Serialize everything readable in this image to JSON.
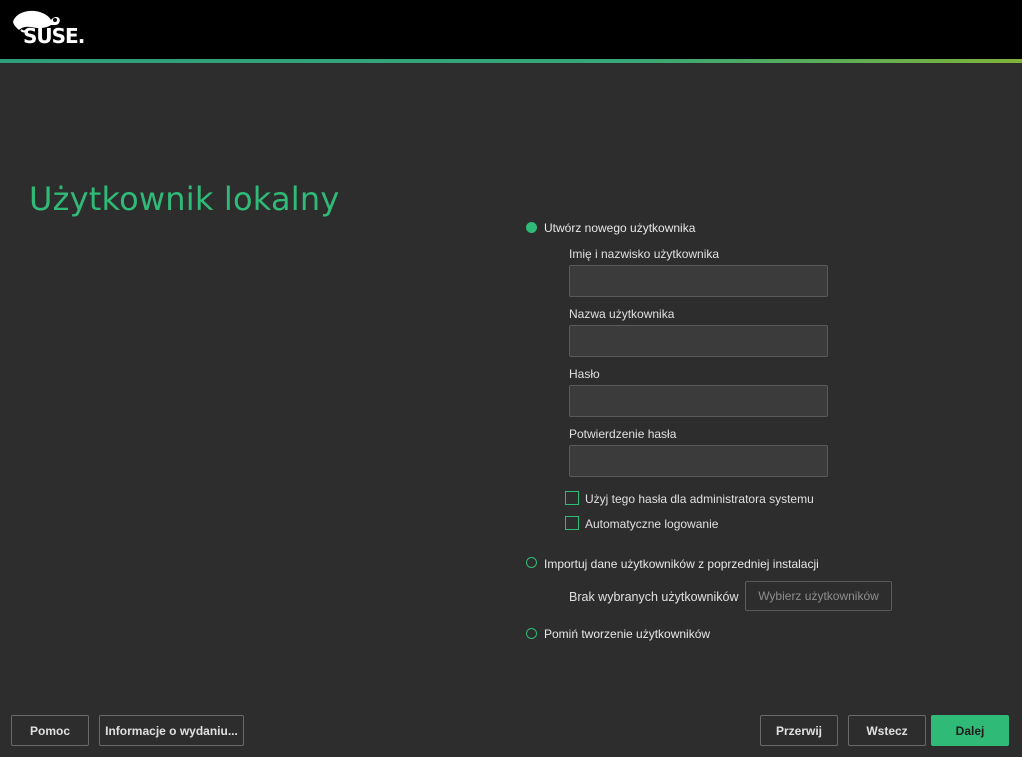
{
  "header": {
    "brand": "SUSE."
  },
  "page": {
    "title": "Użytkownik lokalny"
  },
  "options": {
    "create_user": {
      "label": "Utwórz nowego użytkownika",
      "fields": {
        "full_name_label": "Imię i nazwisko użytkownika",
        "username_label": "Nazwa użytkownika",
        "password_label": "Hasło",
        "confirm_label": "Potwierdzenie hasła"
      },
      "checkboxes": {
        "use_for_admin": "Użyj tego hasła dla administratora systemu",
        "autologin": "Automatyczne logowanie"
      }
    },
    "import_users": {
      "label": "Importuj dane użytkowników z poprzedniej instalacji",
      "status": "Brak wybranych użytkowników",
      "choose_button": "Wybierz użytkowników"
    },
    "skip_users": {
      "label": "Pomiń tworzenie użytkowników"
    }
  },
  "footer": {
    "help": "Pomoc",
    "release_notes": "Informacje o wydaniu...",
    "abort": "Przerwij",
    "back": "Wstecz",
    "next": "Dalej"
  },
  "colors": {
    "accent": "#30ba78",
    "background": "#2d2d2d",
    "topbar": "#000000"
  }
}
